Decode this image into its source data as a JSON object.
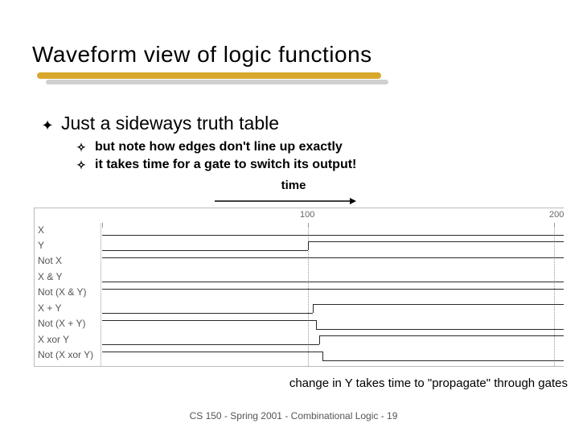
{
  "title": "Waveform view of logic functions",
  "bullets": {
    "main": "Just a sideways truth table",
    "sub1": "but note how edges don't line up exactly",
    "sub2": "it takes time for a gate to switch its output!"
  },
  "time_label": "time",
  "ticks": {
    "t100": "100",
    "t200": "200"
  },
  "rows": {
    "r0": "X",
    "r1": "Y",
    "r2": "Not X",
    "r3": "X & Y",
    "r4": "Not (X & Y)",
    "r5": "X + Y",
    "r6": "Not (X + Y)",
    "r7": "X xor Y",
    "r8": "Not (X xor Y)"
  },
  "caption": "change in Y takes time to \"propagate\" through gates",
  "footer": "CS 150 - Spring  2001 - Combinational Logic - 19",
  "chart_data": {
    "type": "timing-diagram",
    "time_range": [
      0,
      220
    ],
    "signals": [
      {
        "name": "X",
        "initial": 0,
        "transitions": []
      },
      {
        "name": "Y",
        "initial": 0,
        "transitions": [
          {
            "t": 100,
            "to": 1
          }
        ]
      },
      {
        "name": "Not X",
        "initial": 1,
        "transitions": []
      },
      {
        "name": "X & Y",
        "initial": 0,
        "transitions": []
      },
      {
        "name": "Not (X & Y)",
        "initial": 1,
        "transitions": []
      },
      {
        "name": "X + Y",
        "initial": 0,
        "transitions": [
          {
            "t": 102,
            "to": 1
          }
        ]
      },
      {
        "name": "Not (X + Y)",
        "initial": 1,
        "transitions": [
          {
            "t": 103,
            "to": 0
          }
        ]
      },
      {
        "name": "X xor Y",
        "initial": 0,
        "transitions": [
          {
            "t": 104,
            "to": 1
          }
        ]
      },
      {
        "name": "Not (X xor Y)",
        "initial": 1,
        "transitions": [
          {
            "t": 105,
            "to": 0
          }
        ]
      }
    ],
    "dotted_guides_at": [
      100,
      200
    ],
    "note": "Inputs X,Y start low; Y rises at t=100. Derived gate outputs follow with small propagation delay."
  }
}
